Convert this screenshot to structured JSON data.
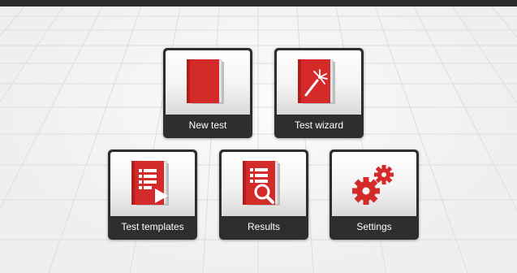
{
  "tiles": {
    "new_test": {
      "label": "New test",
      "icon": "document-icon"
    },
    "test_wizard": {
      "label": "Test wizard",
      "icon": "magic-wand-document-icon"
    },
    "test_templates": {
      "label": "Test templates",
      "icon": "document-play-icon"
    },
    "results": {
      "label": "Results",
      "icon": "document-search-icon"
    },
    "settings": {
      "label": "Settings",
      "icon": "gears-icon"
    }
  },
  "colors": {
    "accent_red": "#d42a2a",
    "tile_frame": "#2e2e2e",
    "top_bar": "#2a2a2a",
    "background": "#efefef"
  }
}
